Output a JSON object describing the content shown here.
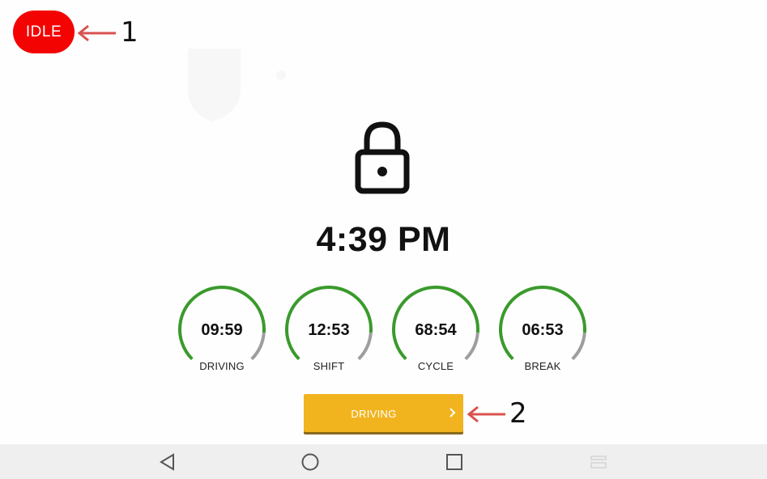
{
  "status": {
    "label": "IDLE",
    "color": "#f40303"
  },
  "annotations": [
    {
      "number": "1",
      "color": "#d9534f"
    },
    {
      "number": "2",
      "color": "#d9534f"
    }
  ],
  "clock": {
    "time": "4:39 PM"
  },
  "timers": [
    {
      "value": "09:59",
      "label": "DRIVING",
      "progress": 0.85
    },
    {
      "value": "12:53",
      "label": "SHIFT",
      "progress": 0.85
    },
    {
      "value": "68:54",
      "label": "CYCLE",
      "progress": 0.85
    },
    {
      "value": "06:53",
      "label": "BREAK",
      "progress": 0.85
    }
  ],
  "colors": {
    "ring_active": "#3a9a2c",
    "ring_remaining": "#9e9e9e",
    "button": "#f2b41e"
  },
  "driving_button": {
    "label": "DRIVING",
    "icon": "chevron-right-icon"
  },
  "nav": {
    "items": [
      "back-icon",
      "home-icon",
      "recents-icon",
      "menu-icon"
    ]
  }
}
